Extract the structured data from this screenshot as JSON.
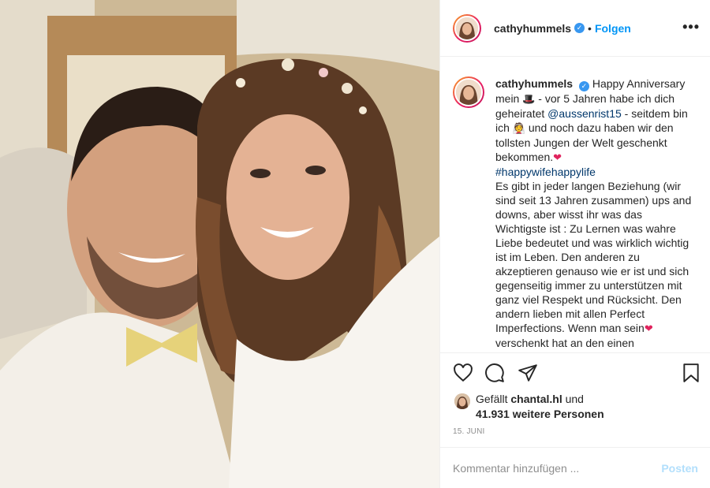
{
  "header": {
    "username": "cathyhummels",
    "separator": "•",
    "follow_label": "Folgen",
    "more_label": "•••"
  },
  "caption": {
    "username": "cathyhummels",
    "segments": [
      {
        "type": "text",
        "value": "Happy Anniversary mein "
      },
      {
        "type": "emoji",
        "value": "🎩",
        "name": "top-hat-emoji"
      },
      {
        "type": "text",
        "value": " - vor 5 Jahren habe ich dich geheiratet "
      },
      {
        "type": "link",
        "value": "@aussenrist15"
      },
      {
        "type": "text",
        "value": " - seitdem bin ich "
      },
      {
        "type": "emoji",
        "value": "👰",
        "name": "bride-emoji"
      },
      {
        "type": "text",
        "value": " und noch dazu haben wir den tollsten Jungen der Welt geschenkt bekommen."
      },
      {
        "type": "emoji",
        "value": "❤",
        "name": "heart-emoji"
      },
      {
        "type": "break"
      },
      {
        "type": "link",
        "value": "#happywifehappylife"
      },
      {
        "type": "break"
      },
      {
        "type": "text",
        "value": "Es gibt in jeder langen Beziehung (wir sind seit 13 Jahren zusammen) ups and downs, aber wisst ihr was das Wichtigste ist : Zu Lernen was wahre Liebe bedeutet und was wirklich wichtig ist im Leben. Den anderen zu akzeptieren genauso wie er ist und sich gegenseitig immer zu unterstützen mit ganz viel Respekt und Rücksicht. Den andern lieben mit allen Perfect Imperfections. Wenn man sein"
      },
      {
        "type": "emoji",
        "value": "❤",
        "name": "heart-emoji"
      },
      {
        "type": "text",
        "value": " verschenkt hat an den einen"
      }
    ]
  },
  "actions": {
    "icons": [
      "heart-icon",
      "comment-icon",
      "share-icon",
      "bookmark-icon"
    ]
  },
  "likes": {
    "prefix": "Gefällt",
    "liker": "chantal.hl",
    "connector": "und",
    "count_text": "41.931 weitere Personen"
  },
  "date": "15. JUNI",
  "comment": {
    "placeholder": "Kommentar hinzufügen ...",
    "post_label": "Posten"
  },
  "colors": {
    "link": "#00376b",
    "follow": "#0095f6",
    "post_disabled": "#b2dffc",
    "verified": "#3897f0",
    "muted": "#8e8e8e"
  }
}
